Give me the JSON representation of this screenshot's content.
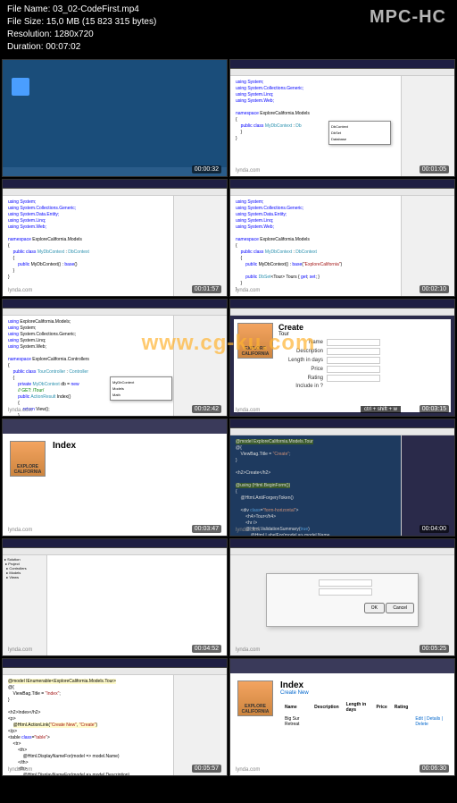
{
  "header": {
    "filename_label": "File Name:",
    "filename": "03_02-CodeFirst.mp4",
    "filesize_label": "File Size:",
    "filesize": "15,0 MB (15 823 315 bytes)",
    "resolution_label": "Resolution:",
    "resolution": "1280x720",
    "duration_label": "Duration:",
    "duration": "00:07:02",
    "player": "MPC-HC"
  },
  "watermark_center": "www.cg-ku.com",
  "brand_label": "lynda.com",
  "tiles": [
    {
      "ts": "00:00:32"
    },
    {
      "ts": "00:01:05"
    },
    {
      "ts": "00:01:57"
    },
    {
      "ts": "00:02:10"
    },
    {
      "ts": "00:02:42"
    },
    {
      "ts": "00:03:15"
    },
    {
      "ts": "00:03:47"
    },
    {
      "ts": "00:04:00"
    },
    {
      "ts": "00:04:52"
    },
    {
      "ts": "00:05:25"
    },
    {
      "ts": "00:05:57"
    },
    {
      "ts": "00:06:30"
    }
  ],
  "code": {
    "usings": "using System;\nusing System.Collections.Generic;\nusing System.Linq;\nusing System.Web;",
    "usings_entity": "using System;\nusing System.Collections.Generic;\nusing System.Data.Entity;\nusing System.Linq;\nusing System.Web;",
    "ns": "namespace ExploreCalifornia.Models",
    "class1": "public class MyDbContext : Db",
    "class2": "public class MyDbContext : DbContext",
    "ctor": "public MyDbContext() : base()",
    "ctor2": "public MyDbContext() : base(\"ExploreCalifornia\")",
    "dbset": "public DbSet<Tour> Tours { get; set; }",
    "controller_ns": "namespace ExploreCalifornia.Controllers",
    "controller_class": "public class TourController : Controller",
    "db_field": "private MyDbContext db = new ",
    "action_comment": "// GET: /Tour/",
    "action": "public ActionResult Index()",
    "return_view": "return View();",
    "model_decl": "@model IEnumerable<ExploreCalifornia.Models.Tour>",
    "model_decl2": "@model ExploreCalifornia.Models.Tour",
    "viewbag": "ViewBag.Title = \"Create\";",
    "viewbag_index": "ViewBag.Title = \"Index\";",
    "h2_create": "<h2>Create</h2>",
    "h2_index": "<h2>Index</h2>",
    "beginform": "@using (Html.BeginForm())",
    "antiforgery": "@Html.AntiForgeryToken()",
    "div_form": "<div class=\"form-horizontal\">",
    "h4_tour": "<h4>Tour</h4>",
    "hr": "<hr />",
    "validation": "@Html.ValidationSummary(true)",
    "labelfor": "@Html.LabelFor(model => model.Name, ",
    "actionlink": "@Html.ActionLink(\"Create New\", \"Create\")",
    "table_open": "<table class=\"table\">",
    "tr": "<tr>",
    "th": "<th>",
    "displaynamefor_name": "@Html.DisplayNameFor(model => model.Name)",
    "displaynamefor_desc": "@Html.DisplayNameFor(model => model.Description)"
  },
  "browser": {
    "index_title": "Index",
    "create_title": "Create",
    "tour_subtitle": "Tour",
    "logo_text": "EXPLORE CALIFORNIA",
    "form_name": "Name",
    "form_desc": "Description",
    "form_length": "Length in days",
    "form_price": "Price",
    "form_rating": "Rating",
    "form_include": "Include in ?",
    "create_link": "Create New",
    "th_name": "Name",
    "th_desc": "Description",
    "th_length": "Length in days",
    "th_price": "Price",
    "th_rating": "Rating",
    "row_big": "Big Sur Retreat",
    "row_edit": "Edit | Details | Delete",
    "shortcut": "ctrl + shift + w"
  }
}
